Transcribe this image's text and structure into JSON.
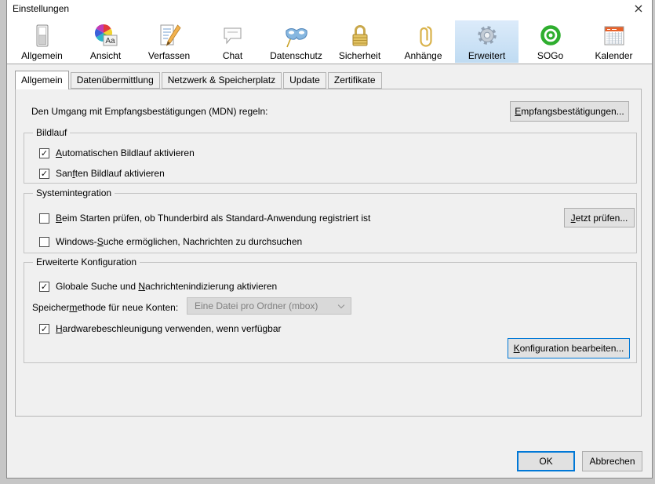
{
  "window": {
    "title": "Einstellungen",
    "close_glyph": "×"
  },
  "colors": {
    "accent": "#0078d7",
    "dialog_bg": "#f0f0f0",
    "toolbar_bg": "#ffffff",
    "toolbar_selected_top": "#dcebfa",
    "toolbar_selected_bottom": "#bfdbf2",
    "button_bg": "#e1e1e1",
    "disabled_select_bg": "#d9d9d9",
    "sogo_green": "#2fae2f",
    "padlock_gold": "#d4af37",
    "calendar_orange": "#e8622a",
    "mask_blue": "#86b7e0"
  },
  "toolbar": {
    "items": [
      {
        "label": "Allgemein",
        "icon": "switch-icon",
        "selected": false
      },
      {
        "label": "Ansicht",
        "icon": "color-wheel-icon",
        "selected": false
      },
      {
        "label": "Verfassen",
        "icon": "compose-icon",
        "selected": false
      },
      {
        "label": "Chat",
        "icon": "chat-bubble-icon",
        "selected": false
      },
      {
        "label": "Datenschutz",
        "icon": "mask-icon",
        "selected": false
      },
      {
        "label": "Sicherheit",
        "icon": "padlock-icon",
        "selected": false
      },
      {
        "label": "Anhänge",
        "icon": "paperclip-icon",
        "selected": false
      },
      {
        "label": "Erweitert",
        "icon": "gear-icon",
        "selected": true
      },
      {
        "label": "SOGo",
        "icon": "sogo-icon",
        "selected": false
      },
      {
        "label": "Kalender",
        "icon": "calendar-icon",
        "selected": false
      }
    ]
  },
  "tabs": [
    {
      "label": "Allgemein",
      "selected": true
    },
    {
      "label": "Datenübermittlung",
      "selected": false
    },
    {
      "label": "Netzwerk & Speicherplatz",
      "selected": false
    },
    {
      "label": "Update",
      "selected": false
    },
    {
      "label": "Zertifikate",
      "selected": false
    }
  ],
  "panel": {
    "mdn": {
      "label": "Den Umgang mit Empfangsbestätigungen (MDN) regeln:",
      "button": {
        "pre": "",
        "accel": "E",
        "post": "mpfangsbestätigungen..."
      }
    },
    "bildlauf": {
      "legend": "Bildlauf",
      "items": [
        {
          "checked": true,
          "pre": "",
          "accel": "A",
          "post": "utomatischen Bildlauf aktivieren"
        },
        {
          "checked": true,
          "pre": "San",
          "accel": "f",
          "post": "ten Bildlauf aktivieren"
        }
      ]
    },
    "system": {
      "legend": "Systemintegration",
      "items": [
        {
          "checked": false,
          "pre": "",
          "accel": "B",
          "post": "eim Starten prüfen, ob Thunderbird als Standard-Anwendung registriert ist"
        },
        {
          "checked": false,
          "pre": "Windows-",
          "accel": "S",
          "post": "uche ermöglichen, Nachrichten zu durchsuchen"
        }
      ],
      "button": {
        "pre": "",
        "accel": "J",
        "post": "etzt prüfen..."
      }
    },
    "advanced": {
      "legend": "Erweiterte Konfiguration",
      "items": [
        {
          "checked": true,
          "pre": "Globale Suche und ",
          "accel": "N",
          "post": "achrichtenindizierung aktivieren"
        },
        {
          "checked": true,
          "pre": "",
          "accel": "H",
          "post": "ardwarebeschleunigung verwenden, wenn verfügbar"
        }
      ],
      "storage_label": {
        "pre": "Speicher",
        "accel": "m",
        "post": "ethode für neue Konten:"
      },
      "storage_value": "Eine Datei pro Ordner (mbox)",
      "button": {
        "pre": "",
        "accel": "K",
        "post": "onfiguration bearbeiten..."
      }
    },
    "footer": {
      "ok": "OK",
      "cancel": "Abbrechen"
    }
  }
}
